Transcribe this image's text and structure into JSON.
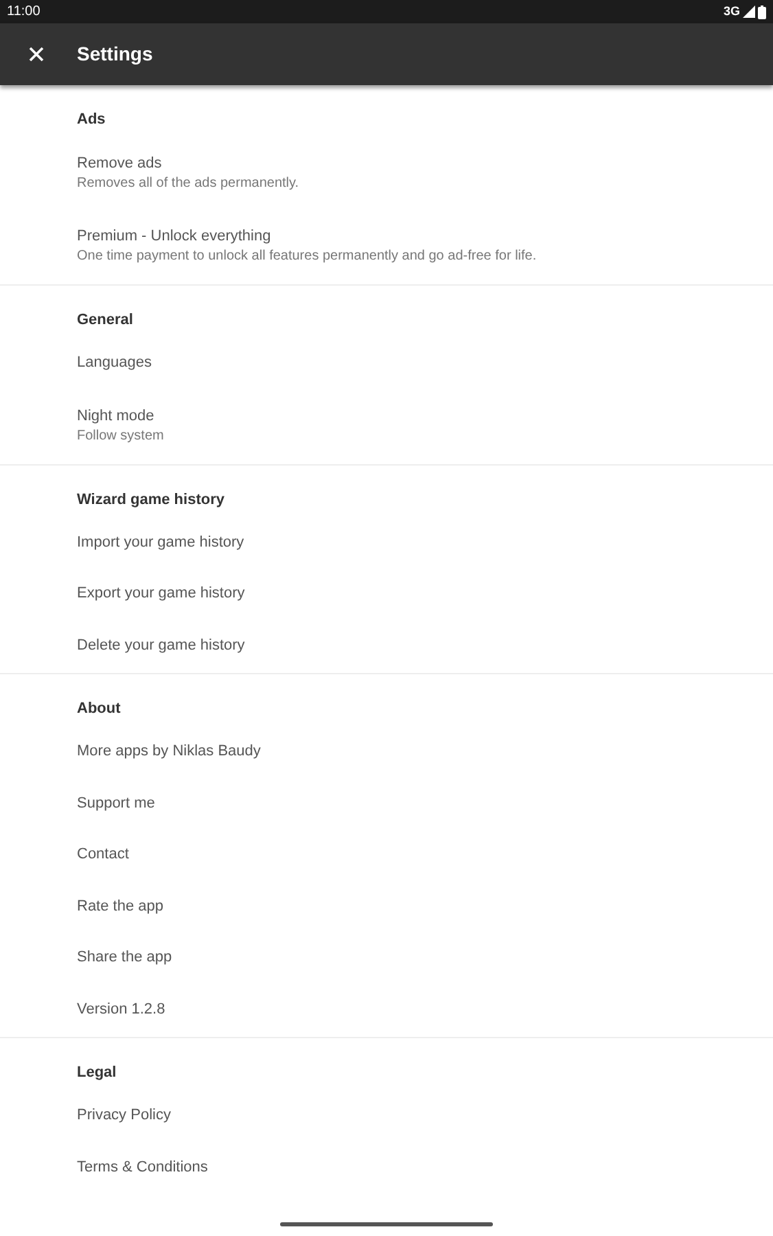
{
  "status_bar": {
    "time": "11:00",
    "network": "3G"
  },
  "toolbar": {
    "title": "Settings"
  },
  "sections": [
    {
      "header": "Ads",
      "items": [
        {
          "title": "Remove ads",
          "summary": "Removes all of the ads permanently."
        },
        {
          "title": "Premium - Unlock everything",
          "summary": "One time payment to unlock all features permanently and go ad-free for life."
        }
      ]
    },
    {
      "header": "General",
      "items": [
        {
          "title": "Languages"
        },
        {
          "title": "Night mode",
          "summary": "Follow system"
        }
      ]
    },
    {
      "header": "Wizard game history",
      "items": [
        {
          "title": "Import your game history"
        },
        {
          "title": "Export your game history"
        },
        {
          "title": "Delete your game history"
        }
      ]
    },
    {
      "header": "About",
      "items": [
        {
          "title": "More apps by Niklas Baudy"
        },
        {
          "title": "Support me"
        },
        {
          "title": "Contact"
        },
        {
          "title": "Rate the app"
        },
        {
          "title": "Share the app"
        },
        {
          "title": "Version 1.2.8"
        }
      ]
    },
    {
      "header": "Legal",
      "items": [
        {
          "title": "Privacy Policy"
        },
        {
          "title": "Terms & Conditions"
        }
      ]
    }
  ]
}
